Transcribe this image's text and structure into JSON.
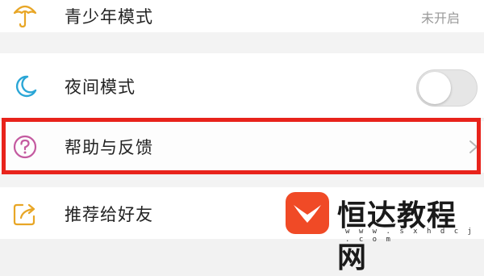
{
  "settings": {
    "items": [
      {
        "label": "青少年模式",
        "value": "未开启",
        "icon": "umbrella-icon"
      },
      {
        "label": "夜间模式",
        "toggle_on": false,
        "icon": "moon-icon"
      },
      {
        "label": "帮助与反馈",
        "icon": "help-circle-icon",
        "chevron": "›"
      },
      {
        "label": "推荐给好友",
        "icon": "share-icon"
      }
    ]
  },
  "watermark": {
    "name": "恒达教程网",
    "url": "w w w . s x h d c j . c o m"
  },
  "colors": {
    "highlight": "#e8231b",
    "youth_icon": "#e8a626",
    "night_icon": "#2aa6d6",
    "help_icon": "#c45aa0",
    "share_icon": "#e8a626",
    "brand_logo": "#f04a26"
  }
}
